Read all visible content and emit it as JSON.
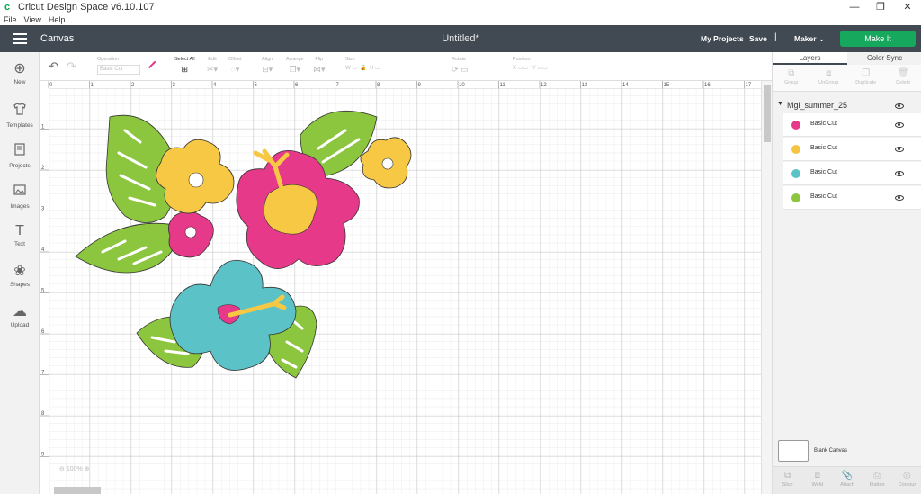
{
  "window": {
    "app_title": "Cricut Design Space  v6.10.107",
    "minimize": "—",
    "restore": "❐",
    "close": "✕"
  },
  "menu": [
    "File",
    "View",
    "Help"
  ],
  "header": {
    "section": "Canvas",
    "doc_title": "Untitled*",
    "my_projects": "My Projects",
    "save": "Save",
    "separator": "|",
    "machine": "Maker",
    "make_it": "Make It"
  },
  "leftbar": [
    {
      "label": "New",
      "icon": "plus-circle-icon",
      "glyph": "⊕"
    },
    {
      "label": "Templates",
      "icon": "shirt-icon",
      "glyph": "👕"
    },
    {
      "label": "Projects",
      "icon": "projects-icon",
      "glyph": "▯"
    },
    {
      "label": "Images",
      "icon": "image-icon",
      "glyph": "▨"
    },
    {
      "label": "Text",
      "icon": "text-icon",
      "glyph": "T"
    },
    {
      "label": "Shapes",
      "icon": "shapes-icon",
      "glyph": "❀"
    },
    {
      "label": "Upload",
      "icon": "upload-icon",
      "glyph": "☁"
    }
  ],
  "toolbar": {
    "operation_label": "Operation",
    "operation_value": "Basic Cut",
    "select_all": "Select All",
    "edit": "Edit",
    "offset": "Offset",
    "align": "Align",
    "arrange": "Arrange",
    "flip": "Flip",
    "size": "Size",
    "w": "W",
    "h": "H",
    "rotate": "Rotate",
    "position": "Position",
    "x": "X",
    "y": "Y"
  },
  "ruler": {
    "top": [
      "0",
      "1",
      "2",
      "3",
      "4",
      "5",
      "6",
      "7",
      "8",
      "9",
      "10",
      "11",
      "12",
      "13",
      "14",
      "15",
      "16",
      "17"
    ],
    "left": [
      "1",
      "2",
      "3",
      "4",
      "5",
      "6",
      "7",
      "8",
      "9"
    ]
  },
  "zoom": "100%",
  "panel": {
    "tabs": [
      "Layers",
      "Color Sync"
    ],
    "actions": [
      "Group",
      "UnGroup",
      "Duplicate",
      "Delete"
    ],
    "group_name": "Mgl_summer_25",
    "layers": [
      {
        "label": "Basic Cut",
        "color": "#e6398a"
      },
      {
        "label": "Basic Cut",
        "color": "#f6c343"
      },
      {
        "label": "Basic Cut",
        "color": "#5bc3c8"
      },
      {
        "label": "Basic Cut",
        "color": "#8cc63f"
      }
    ],
    "blank_canvas": "Blank Canvas",
    "bottom_actions": [
      "Slice",
      "Weld",
      "Attach",
      "Flatten",
      "Contour"
    ]
  },
  "colors": {
    "pink": "#e6398a",
    "yellow": "#f7c843",
    "teal": "#5bc3c8",
    "green": "#8cc63f",
    "header": "#414a52",
    "make_it": "#16a85c"
  }
}
